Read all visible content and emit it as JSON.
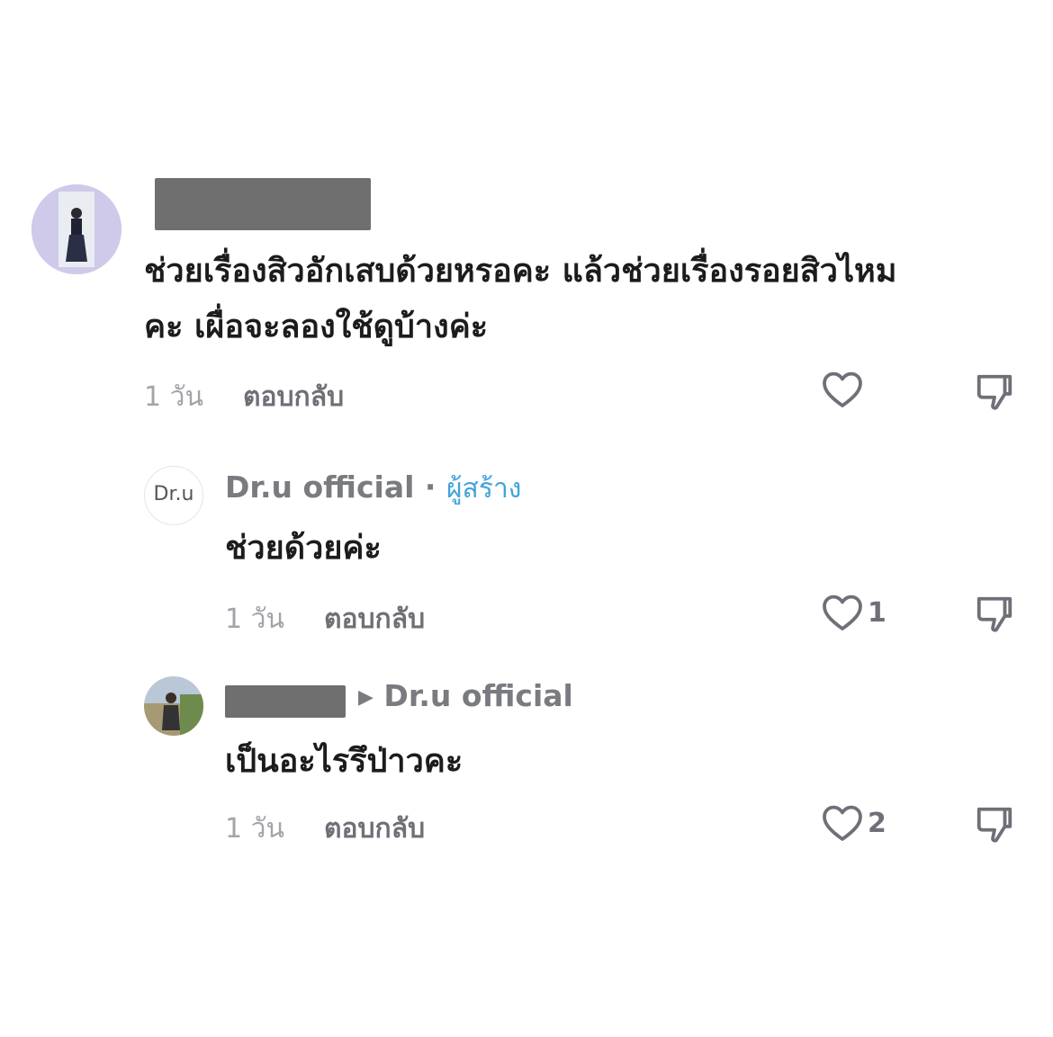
{
  "comments": [
    {
      "text_line1": "ช่วยเรื่องสิวอักเสบด้วยหรอคะ แล้วช่วยเรื่องรอยสิวไหม",
      "text_line2": "คะ เผื่อจะลองใช้ดูบ้างค่ะ",
      "time": "1 วัน",
      "reply_label": "ตอบกลับ",
      "like_count": ""
    },
    {
      "username": "Dr.u official",
      "separator": " · ",
      "creator_badge": "ผู้สร้าง",
      "avatar_logo": "Dr.u",
      "text": "ช่วยด้วยค่ะ",
      "time": "1 วัน",
      "reply_label": "ตอบกลับ",
      "like_count": "1"
    },
    {
      "reply_to": "Dr.u official",
      "text": "เป็นอะไรรึป่าวคะ",
      "time": "1 วัน",
      "reply_label": "ตอบกลับ",
      "like_count": "2"
    }
  ],
  "colors": {
    "creator": "#42a3d9",
    "redaction": "#6f6f6f"
  },
  "icons": [
    "heart-icon",
    "dislike-icon",
    "play-arrow-icon"
  ]
}
